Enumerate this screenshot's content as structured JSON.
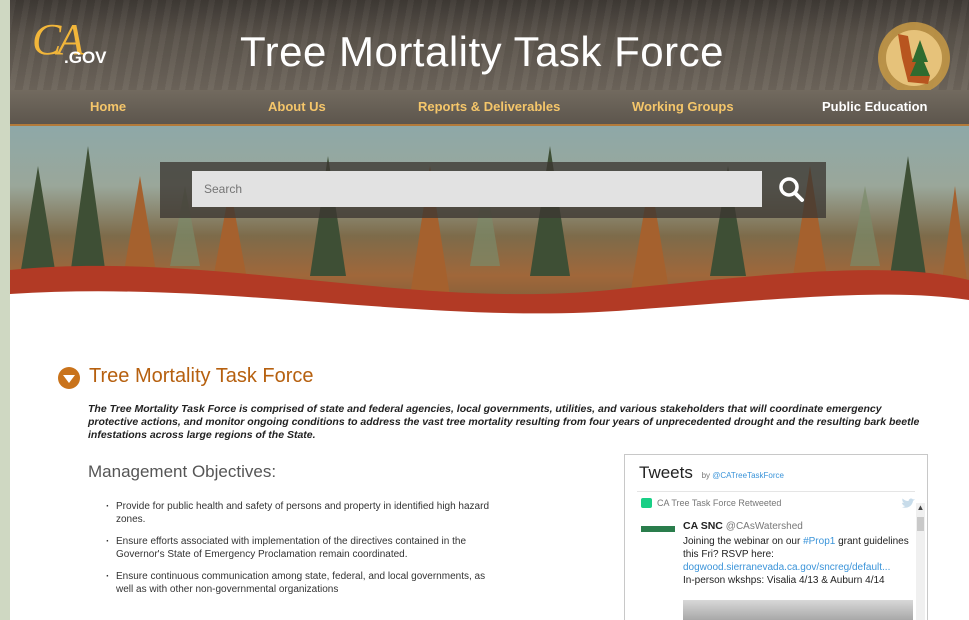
{
  "header": {
    "logo_ca": "CA",
    "logo_gov": ".GOV",
    "title": "Tree Mortality Task Force"
  },
  "nav": {
    "items": [
      "Home",
      "About Us",
      "Reports & Deliverables",
      "Working Groups",
      "Public Education"
    ]
  },
  "search": {
    "placeholder": "Search",
    "icon": "search-icon"
  },
  "content": {
    "section_title": "Tree Mortality Task Force",
    "intro": "The Tree Mortality Task Force is comprised of state and federal agencies, local governments, utilities, and various stakeholders that will coordinate emergency protective actions, and monitor ongoing conditions to address the vast tree mortality resulting from four years of unprecedented drought and the resulting bark beetle infestations across large regions of the State.",
    "subhead": "Management Objectives:",
    "objectives": [
      "Provide for public health and safety of persons and property in identified high hazard zones.",
      "Ensure efforts associated with implementation of the directives contained in the Governor's State of Emergency Proclamation remain coordinated.",
      "Ensure continuous communication among state, federal, and local governments, as well as with other non-governmental organizations"
    ]
  },
  "tweets": {
    "title": "Tweets",
    "by": "by",
    "handle": "@CATreeTaskForce",
    "retweet_label": "CA Tree Task Force Retweeted",
    "author_name": "CA SNC",
    "author_handle": "@CAsWatershed",
    "text_1": "Joining the webinar on our ",
    "hashtag": "#Prop1",
    "text_2": " grant guidelines this Fri? RSVP here:",
    "link": "dogwood.sierranevada.ca.gov/sncreg/default...",
    "text_3": "In-person wkshps: Visalia 4/13 & Auburn 4/14"
  },
  "colors": {
    "accent_orange": "#b6600f",
    "nav_text": "#f5c66a",
    "link_blue": "#3b94d9"
  }
}
